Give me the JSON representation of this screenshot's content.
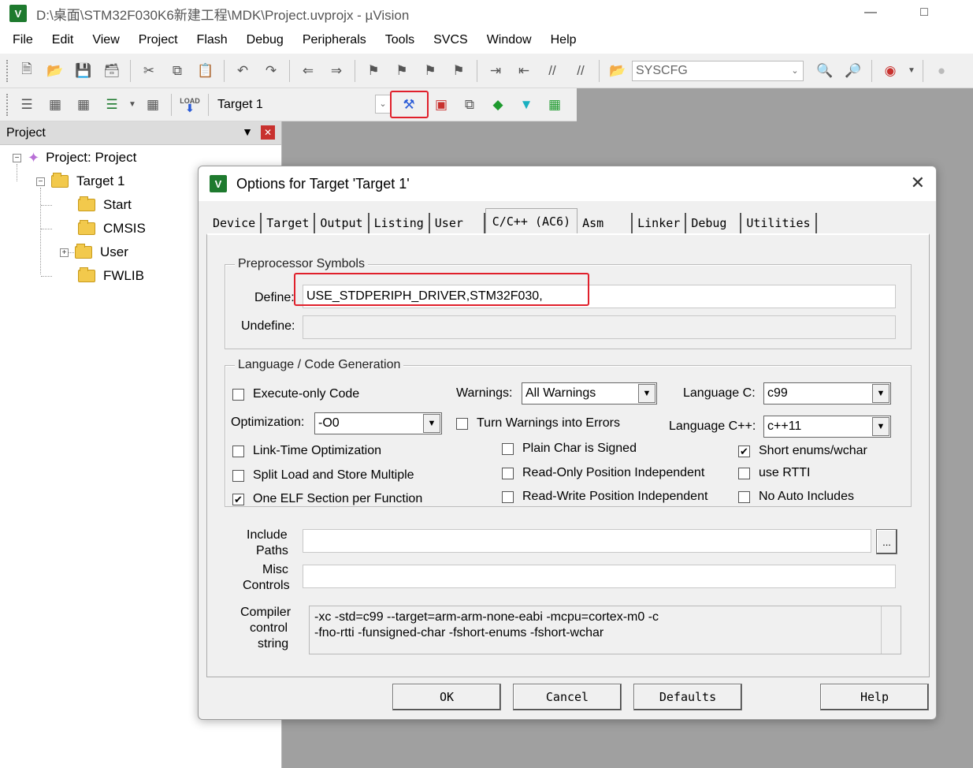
{
  "window": {
    "title": "D:\\桌面\\STM32F030K6新建工程\\MDK\\Project.uvprojx - µVision",
    "icon": "V"
  },
  "menu": [
    "File",
    "Edit",
    "View",
    "Project",
    "Flash",
    "Debug",
    "Peripherals",
    "Tools",
    "SVCS",
    "Window",
    "Help"
  ],
  "toolbar": {
    "peripheral_combo": "SYSCFG",
    "target_combo": "Target 1",
    "load_label": "LOAD"
  },
  "project_pane": {
    "title": "Project",
    "root": "Project: Project",
    "target": "Target 1",
    "groups": [
      "Start",
      "CMSIS",
      "User",
      "FWLIB"
    ]
  },
  "dialog": {
    "title": "Options for Target 'Target 1'",
    "tabs": [
      "Device",
      "Target",
      "Output",
      "Listing",
      "User",
      "C/C++ (AC6)",
      "Asm",
      "Linker",
      "Debug",
      "Utilities"
    ],
    "active_tab": "C/C++ (AC6)",
    "preprocessor": {
      "group_label": "Preprocessor Symbols",
      "define_label": "Define:",
      "define_value": "USE_STDPERIPH_DRIVER,STM32F030,",
      "undefine_label": "Undefine:",
      "undefine_value": ""
    },
    "language": {
      "group_label": "Language / Code Generation",
      "execute_only": {
        "label": "Execute-only Code",
        "checked": false
      },
      "warnings_label": "Warnings:",
      "warnings_value": "All Warnings",
      "language_c_label": "Language C:",
      "language_c_value": "c99",
      "optimization_label": "Optimization:",
      "optimization_value": "-O0",
      "turn_warnings": {
        "label": "Turn Warnings into Errors",
        "checked": false
      },
      "language_cpp_label": "Language C++:",
      "language_cpp_value": "c++11",
      "lto": {
        "label": "Link-Time Optimization",
        "checked": false
      },
      "plain_char": {
        "label": "Plain Char is Signed",
        "checked": false
      },
      "short_enums": {
        "label": "Short enums/wchar",
        "checked": true
      },
      "split_load": {
        "label": "Split Load and Store Multiple",
        "checked": false
      },
      "ropi": {
        "label": "Read-Only Position Independent",
        "checked": false
      },
      "rtti": {
        "label": "use RTTI",
        "checked": false
      },
      "one_elf": {
        "label": "One ELF Section per Function",
        "checked": true
      },
      "rwpi": {
        "label": "Read-Write Position Independent",
        "checked": false
      },
      "no_auto": {
        "label": "No Auto Includes",
        "checked": false
      }
    },
    "include_paths_label_1": "Include",
    "include_paths_label_2": "Paths",
    "include_paths_value": "",
    "browse_label": "...",
    "misc_label_1": "Misc",
    "misc_label_2": "Controls",
    "misc_value": "",
    "compiler_label_1": "Compiler",
    "compiler_label_2": "control",
    "compiler_label_3": "string",
    "compiler_line_1": "-xc -std=c99 --target=arm-arm-none-eabi -mcpu=cortex-m0 -c",
    "compiler_line_2": "-fno-rtti -funsigned-char -fshort-enums -fshort-wchar",
    "buttons": {
      "ok": "OK",
      "cancel": "Cancel",
      "defaults": "Defaults",
      "help": "Help"
    }
  }
}
